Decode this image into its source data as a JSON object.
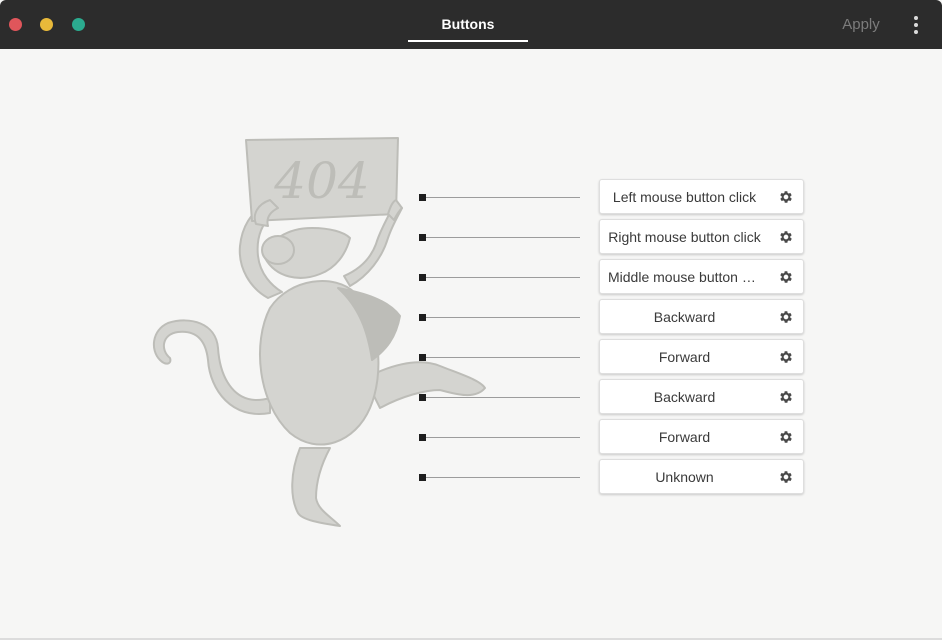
{
  "window": {
    "title_tab": "Buttons",
    "apply_label": "Apply"
  },
  "illustration": {
    "sign_text": "404"
  },
  "buttons": [
    {
      "label": "Left mouse button click"
    },
    {
      "label": "Right mouse button click"
    },
    {
      "label": "Middle mouse button click"
    },
    {
      "label": "Backward"
    },
    {
      "label": "Forward"
    },
    {
      "label": "Backward"
    },
    {
      "label": "Forward"
    },
    {
      "label": "Unknown"
    }
  ],
  "icons": {
    "settings": "gear-icon",
    "menu": "kebab-menu-icon"
  },
  "colors": {
    "titlebar": "#2c2c2c",
    "close": "#e0565b",
    "minimize": "#e8b93a",
    "maximize": "#2bab8f",
    "illustration": "#d4d4d0"
  }
}
